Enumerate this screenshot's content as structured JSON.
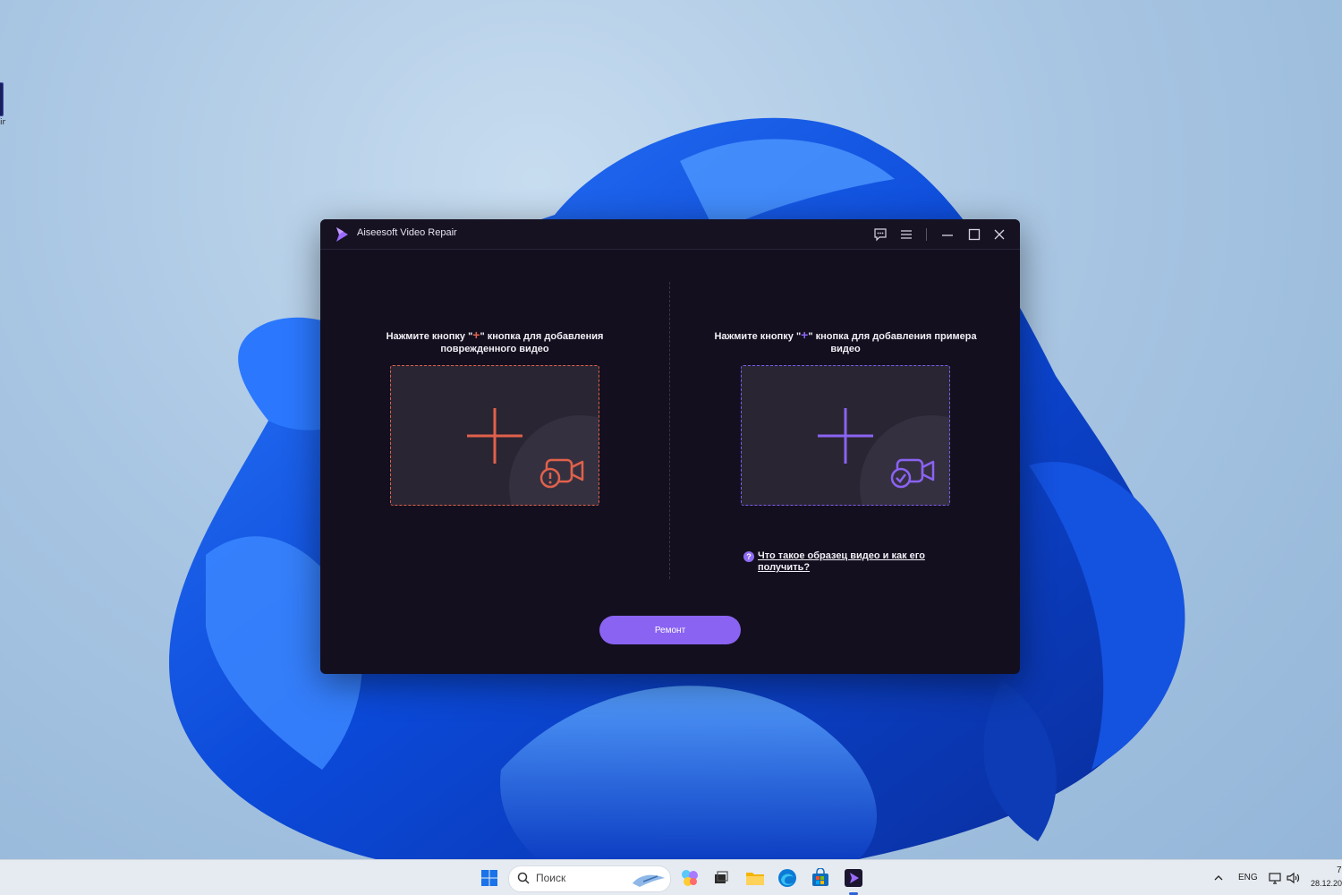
{
  "window": {
    "title": "Aiseesoft Video Repair"
  },
  "left_panel": {
    "instruction_before": "Нажмите кнопку \"",
    "instruction_plus": "+",
    "instruction_after": "\" кнопка для добавления",
    "instruction_line2": "поврежденного видео",
    "accent": "#e0614b"
  },
  "right_panel": {
    "instruction_before": "Нажмите кнопку \"",
    "instruction_plus": "+",
    "instruction_after": "\" кнопка для добавления примера",
    "instruction_line2": "видео",
    "accent": "#8a63f2",
    "help_icon": "?",
    "help_link": "Что такое образец видео и как его получить?"
  },
  "repair_button": "Ремонт",
  "taskbar": {
    "search_placeholder": "Поиск",
    "language": "ENG",
    "date": "28.12.20",
    "time_fragment": "7"
  },
  "icons": {
    "logo": "app-logo-icon",
    "feedback": "feedback-icon",
    "menu": "menu-icon",
    "minimize": "minimize-icon",
    "maximize": "maximize-icon",
    "close": "close-icon"
  }
}
